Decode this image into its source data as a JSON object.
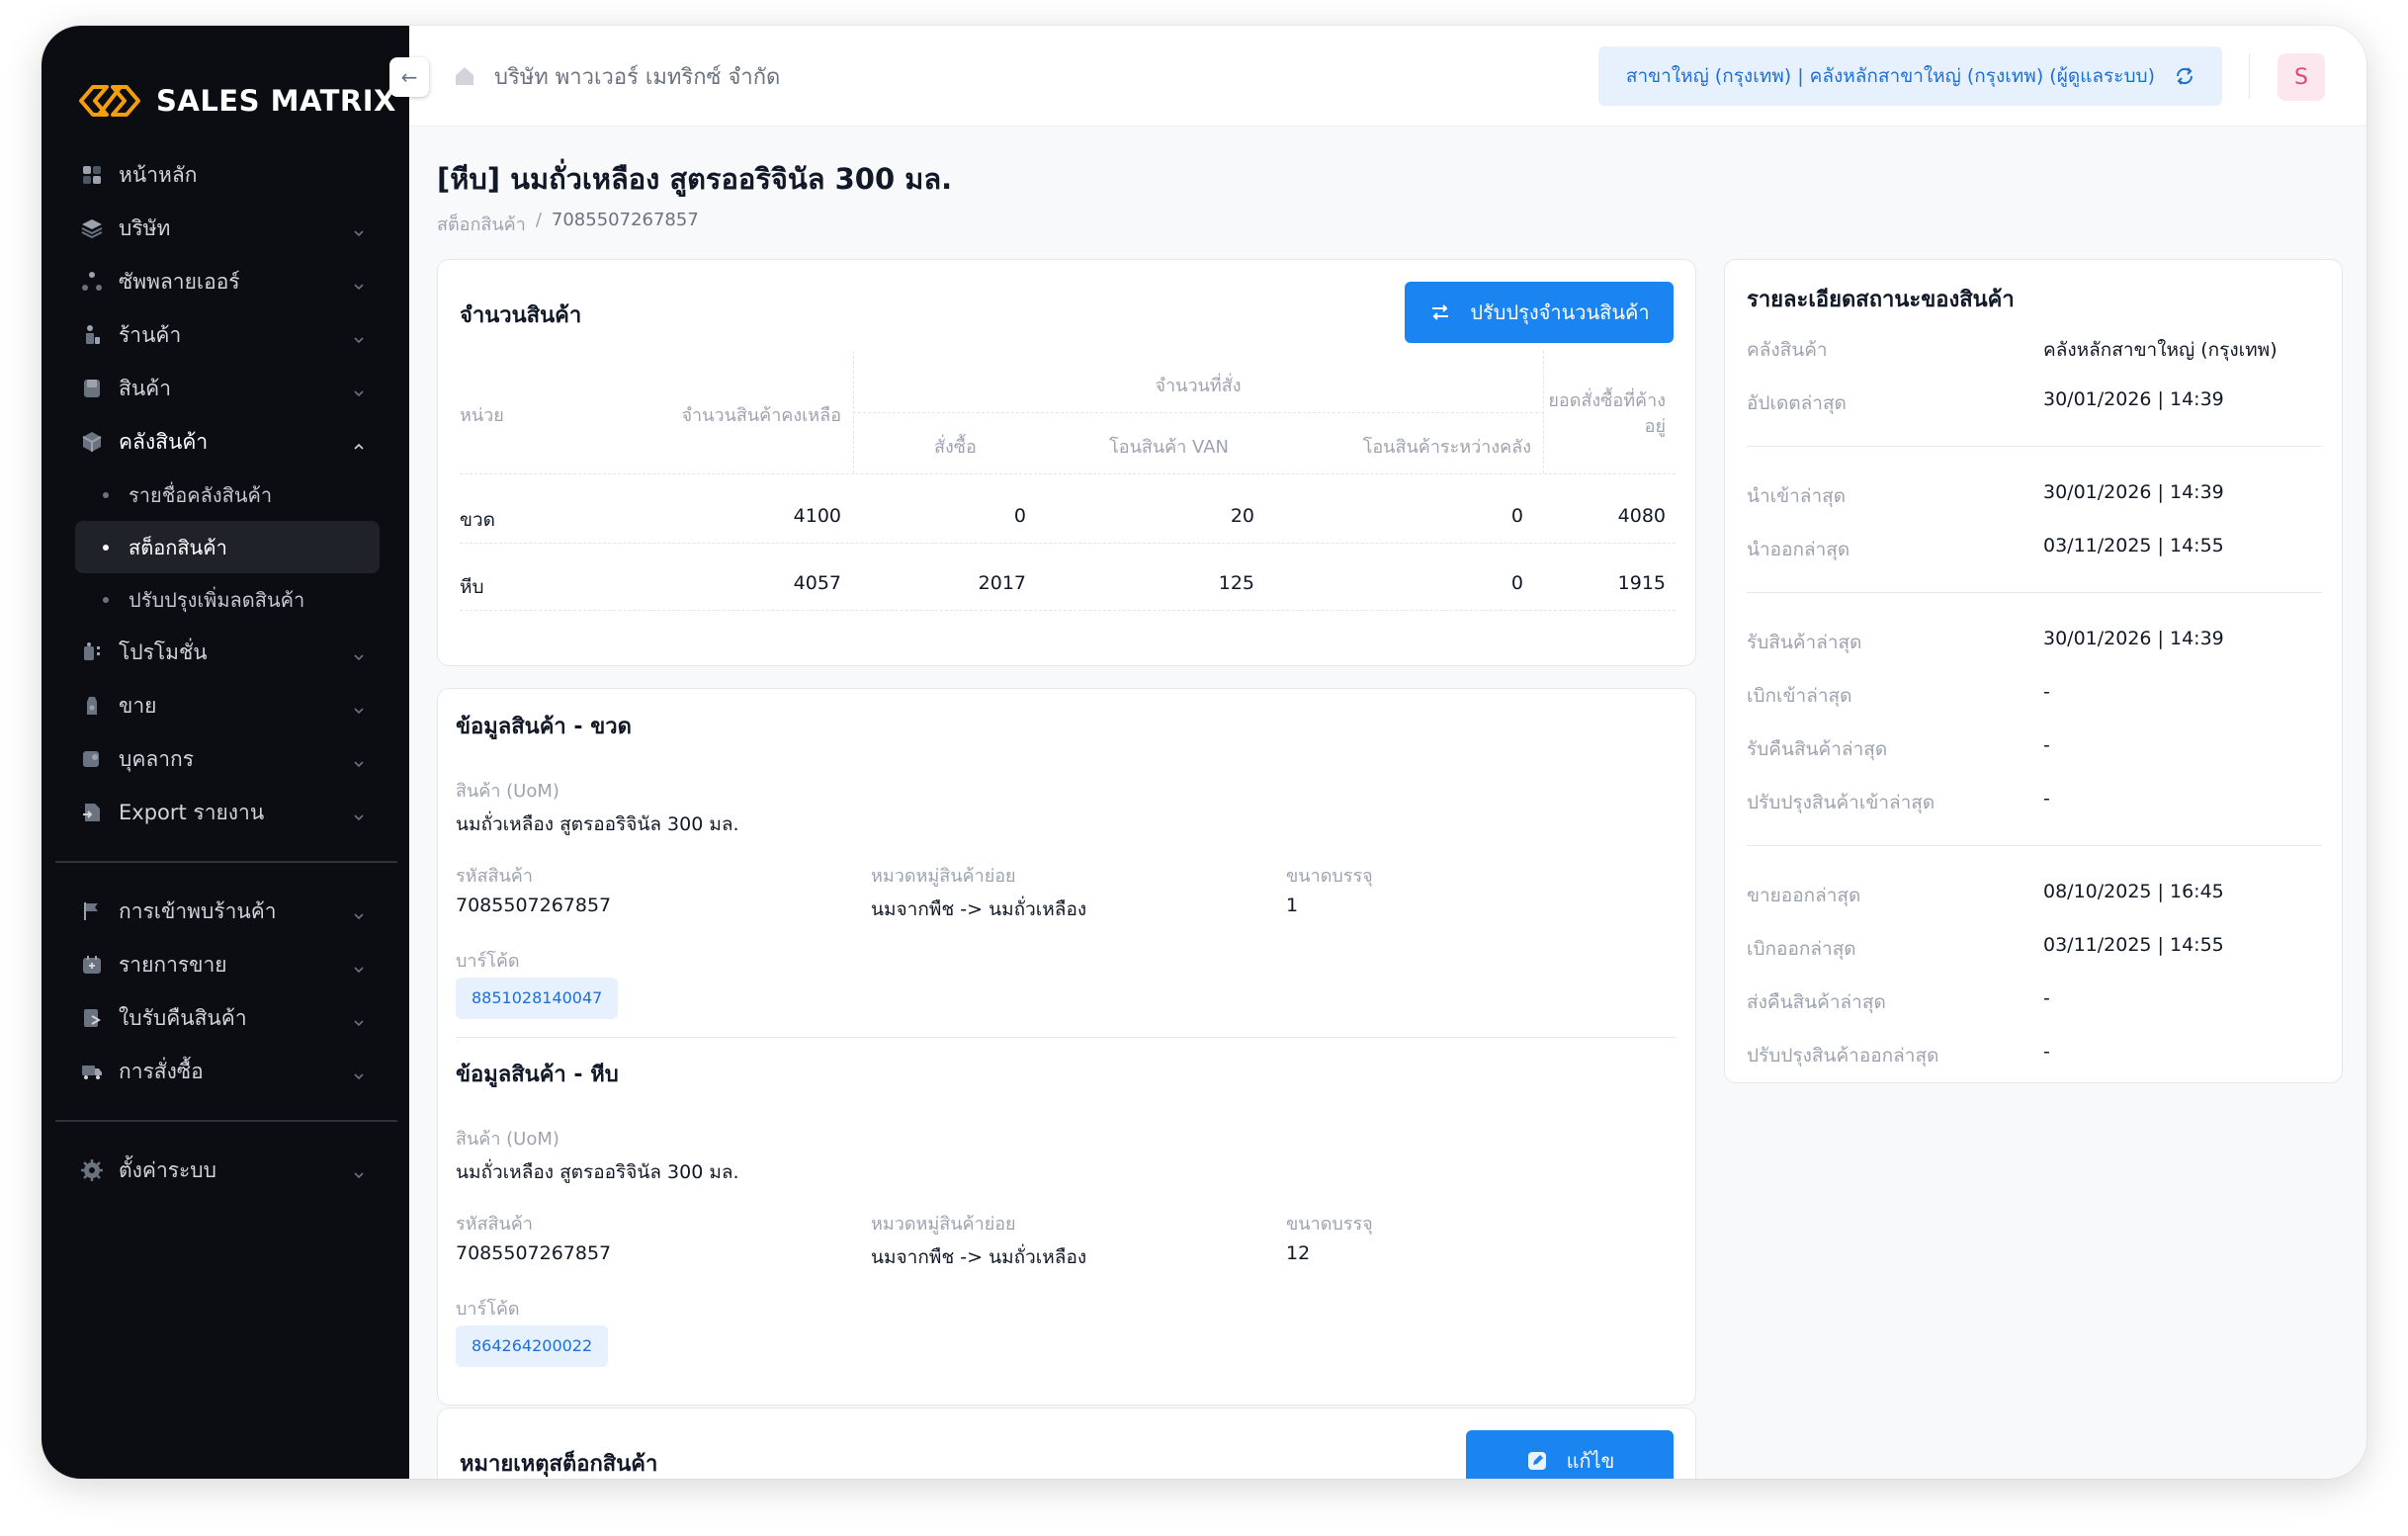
{
  "app": {
    "name": "SALES MATRIX"
  },
  "sidebar": {
    "items": [
      {
        "label": "หน้าหลัก",
        "icon": "dashboard-icon",
        "has_chevron": false
      },
      {
        "label": "บริษัท",
        "icon": "layers-icon",
        "has_chevron": true
      },
      {
        "label": "ซัพพลายเออร์",
        "icon": "network-icon",
        "has_chevron": true
      },
      {
        "label": "ร้านค้า",
        "icon": "store-icon",
        "has_chevron": true
      },
      {
        "label": "สินค้า",
        "icon": "product-icon",
        "has_chevron": true
      },
      {
        "label": "คลังสินค้า",
        "icon": "box-icon",
        "has_chevron": true,
        "expanded": true
      }
    ],
    "warehouse_sub": [
      {
        "label": "รายชื่อคลังสินค้า",
        "active": false
      },
      {
        "label": "สต็อกสินค้า",
        "active": true
      },
      {
        "label": "ปรับปรุงเพิ่มลดสินค้า",
        "active": false
      }
    ],
    "items_after": [
      {
        "label": "โปรโมชั่น",
        "icon": "promotion-icon"
      },
      {
        "label": "ขาย",
        "icon": "sales-icon"
      },
      {
        "label": "บุคลากร",
        "icon": "person-icon"
      },
      {
        "label": "Export รายงาน",
        "icon": "export-icon"
      }
    ],
    "group2": [
      {
        "label": "การเข้าพบร้านค้า",
        "icon": "flag-icon"
      },
      {
        "label": "รายการขาย",
        "icon": "calendar-icon"
      },
      {
        "label": "ใบรับคืนสินค้า",
        "icon": "return-icon"
      },
      {
        "label": "การสั่งซื้อ",
        "icon": "truck-icon"
      }
    ],
    "group3": [
      {
        "label": "ตั้งค่าระบบ",
        "icon": "gear-icon"
      }
    ]
  },
  "topbar": {
    "company": "บริษัท พาวเวอร์ เมทริกซ์ จำกัด",
    "branch": "สาขาใหญ่ (กรุงเทพ) | คลังหลักสาขาใหญ่ (กรุงเทพ) (ผู้ดูแลระบบ)",
    "avatar": "S",
    "collapse_glyph": "←"
  },
  "page": {
    "title": "[หีบ] นมถั่วเหลือง สูตรออริจินัล 300 มล.",
    "breadcrumb_parent": "สต็อกสินค้า",
    "breadcrumb_sep": "/",
    "breadcrumb_current": "7085507267857"
  },
  "stock": {
    "title": "จำนวนสินค้า",
    "adjust_button": "ปรับปรุงจำนวนสินค้า",
    "headers": {
      "unit": "หน่วย",
      "remaining": "จำนวนสินค้าคงเหลือ",
      "ordered_group": "จำนวนที่สั่ง",
      "purchase": "สั่งซื้อ",
      "van": "โอนสินค้า VAN",
      "between": "โอนสินค้าระหว่างคลัง",
      "pending_line1": "ยอดสั่งซื้อที่ค้าง",
      "pending_line2": "อยู่"
    },
    "rows": [
      {
        "unit": "ขวด",
        "remaining": "4100",
        "purchase": "0",
        "van": "20",
        "between": "0",
        "pending": "4080"
      },
      {
        "unit": "หีบ",
        "remaining": "4057",
        "purchase": "2017",
        "van": "125",
        "between": "0",
        "pending": "1915"
      }
    ]
  },
  "products": [
    {
      "title": "ข้อมูลสินค้า - ขวด",
      "uom_label": "สินค้า (UoM)",
      "uom_value": "นมถั่วเหลือง สูตรออริจินัล 300 มล.",
      "code_label": "รหัสสินค้า",
      "code_value": "7085507267857",
      "category_label": "หมวดหมู่สินค้าย่อย",
      "category_value": "นมจากพืช -> นมถั่วเหลือง",
      "pack_label": "ขนาดบรรจุ",
      "pack_value": "1",
      "barcode_label": "บาร์โค้ด",
      "barcode_value": "8851028140047"
    },
    {
      "title": "ข้อมูลสินค้า - หีบ",
      "uom_label": "สินค้า (UoM)",
      "uom_value": "นมถั่วเหลือง สูตรออริจินัล 300 มล.",
      "code_label": "รหัสสินค้า",
      "code_value": "7085507267857",
      "category_label": "หมวดหมู่สินค้าย่อย",
      "category_value": "นมจากพืช -> นมถั่วเหลือง",
      "pack_label": "ขนาดบรรจุ",
      "pack_value": "12",
      "barcode_label": "บาร์โค้ด",
      "barcode_value": "864264200022"
    }
  ],
  "notes": {
    "title": "หมายเหตุสต็อกสินค้า",
    "edit_button": "แก้ไข"
  },
  "status": {
    "title": "รายละเอียดสถานะของสินค้า",
    "groups": [
      [
        {
          "label": "คลังสินค้า",
          "value": "คลังหลักสาขาใหญ่ (กรุงเทพ)"
        },
        {
          "label": "อัปเดตล่าสุด",
          "value": "30/01/2026 | 14:39"
        }
      ],
      [
        {
          "label": "นำเข้าล่าสุด",
          "value": "30/01/2026 | 14:39"
        },
        {
          "label": "นำออกล่าสุด",
          "value": "03/11/2025 | 14:55"
        }
      ],
      [
        {
          "label": "รับสินค้าล่าสุด",
          "value": "30/01/2026 | 14:39"
        },
        {
          "label": "เบิกเข้าล่าสุด",
          "value": "-"
        },
        {
          "label": "รับคืนสินค้าล่าสุด",
          "value": "-"
        },
        {
          "label": "ปรับปรุงสินค้าเข้าล่าสุด",
          "value": "-"
        }
      ],
      [
        {
          "label": "ขายออกล่าสุด",
          "value": "08/10/2025 | 16:45"
        },
        {
          "label": "เบิกออกล่าสุด",
          "value": "03/11/2025 | 14:55"
        },
        {
          "label": "ส่งคืนสินค้าล่าสุด",
          "value": "-"
        },
        {
          "label": "ปรับปรุงสินค้าออกล่าสุด",
          "value": "-"
        }
      ]
    ]
  },
  "colors": {
    "accent": "#1a84f0",
    "sidebar_bg": "#0b0d12",
    "logo_orange": "#f59e0b",
    "pill_bg": "#e6f1fd",
    "avatar_bg": "#fde7ee"
  }
}
